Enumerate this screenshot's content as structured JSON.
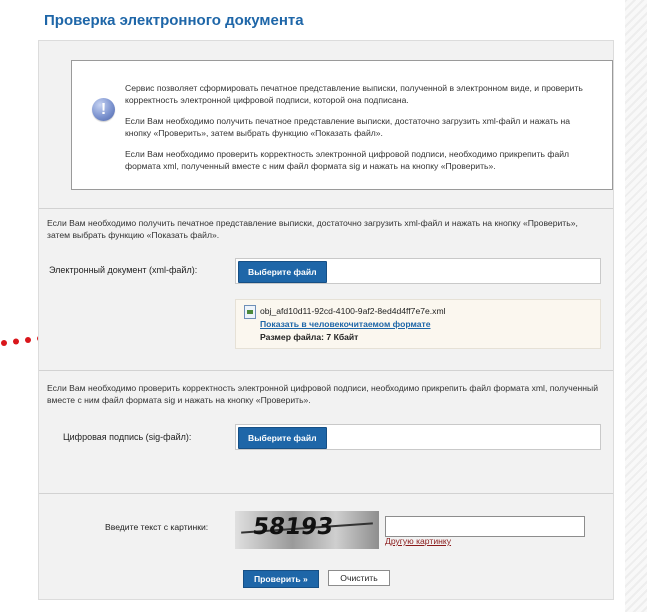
{
  "page": {
    "title": "Проверка электронного документа"
  },
  "info": {
    "paragraph1": "Сервис позволяет сформировать печатное представление выписки, полученной в электронном виде, и проверить корректность электронной цифровой подписи, которой она подписана.",
    "paragraph2": "Если Вам необходимо получить печатное представление выписки, достаточно загрузить xml-файл и нажать на кнопку «Проверить», затем выбрать функцию «Показать файл».",
    "paragraph3": "Если Вам необходимо проверить корректность электронной цифровой подписи, необходимо прикрепить файл формата xml, полученный вместе с ним файл формата sig и нажать на кнопку «Проверить»."
  },
  "section1": {
    "description": "Если Вам необходимо получить печатное представление выписки, достаточно загрузить xml-файл и нажать на кнопку «Проверить», затем выбрать функцию «Показать файл».",
    "label": "Электронный документ (xml-файл):",
    "button": "Выберите файл",
    "file": {
      "name": "obj_afd10d11-92cd-4100-9af2-8ed4d4ff7e7e.xml",
      "link": "Показать в человекочитаемом формате",
      "size": "Размер файла: 7 Кбайт"
    }
  },
  "section2": {
    "description": "Если Вам необходимо проверить корректность электронной цифровой подписи, необходимо прикрепить файл формата xml, полученный вместе с ним файл формата sig и нажать на кнопку «Проверить».",
    "label": "Цифровая подпись (sig-файл):",
    "button": "Выберите файл"
  },
  "captcha": {
    "label": "Введите текст с картинки:",
    "image_text": "58193",
    "input_value": "",
    "refresh_link": "Другую картинку"
  },
  "actions": {
    "submit": "Проверить »",
    "clear": "Очистить"
  },
  "colors": {
    "accent": "#1e66a8",
    "annotation": "#d9161b"
  }
}
